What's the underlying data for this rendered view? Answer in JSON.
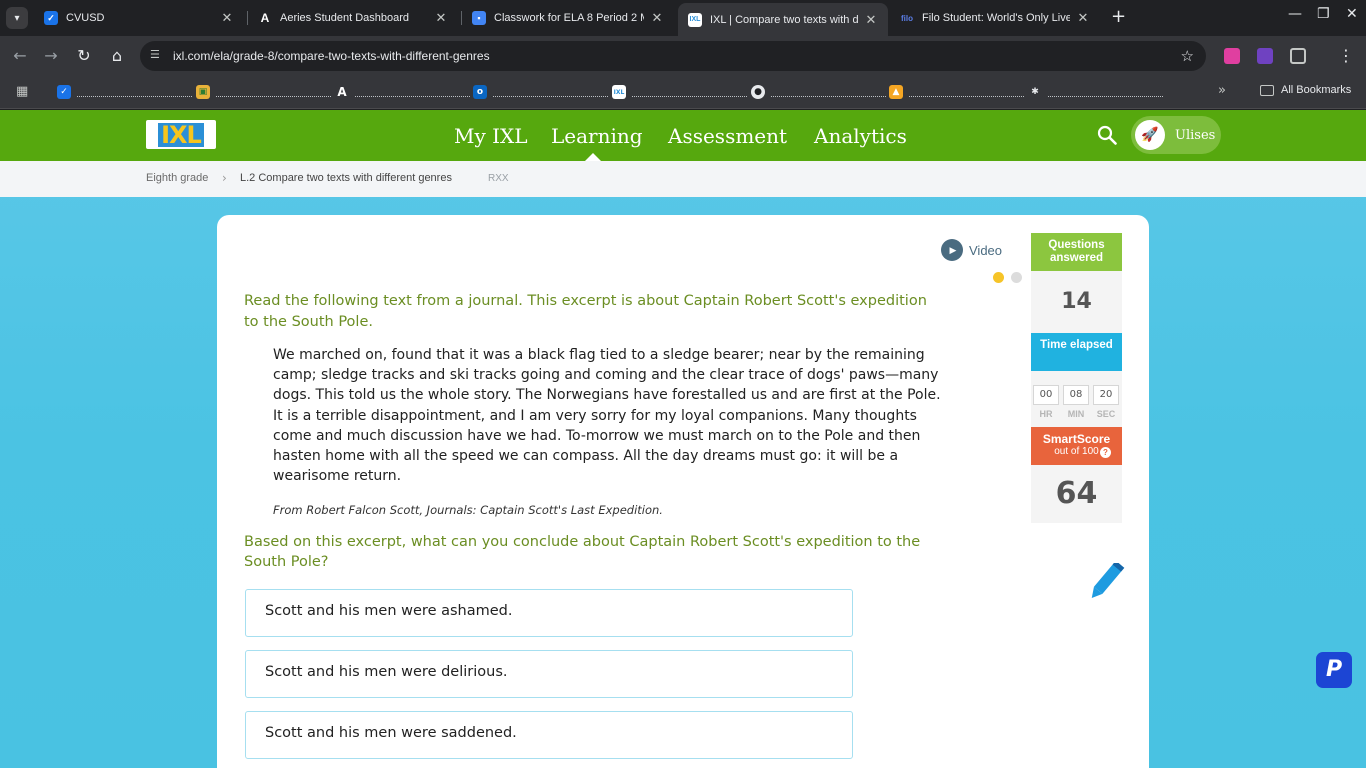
{
  "browser": {
    "tabs": [
      {
        "title": "CVUSD",
        "active": false
      },
      {
        "title": "Aeries Student Dashboard",
        "active": false
      },
      {
        "title": "Classwork for ELA 8 Period 2 M",
        "active": false
      },
      {
        "title": "IXL | Compare two texts with di",
        "active": true
      },
      {
        "title": "Filo Student: World's Only Live I",
        "active": false
      }
    ],
    "url": "ixl.com/ela/grade-8/compare-two-texts-with-different-genres",
    "bookmarks_all_label": "All Bookmarks"
  },
  "ixl": {
    "logo": "IXL",
    "nav": [
      "My IXL",
      "Learning",
      "Assessment",
      "Analytics"
    ],
    "active_nav": "Learning",
    "user_name": "Ulises",
    "breadcrumb": {
      "grade": "Eighth grade",
      "skill": "L.2 Compare two texts with different genres",
      "code": "RXX"
    },
    "video_label": "Video",
    "prompt": "Read the following text from a journal. This excerpt is about Captain Robert Scott's expedition to the South Pole.",
    "passage": "We marched on, found that it was a black flag tied to a sledge bearer; near by the remaining camp; sledge tracks and ski tracks going and coming and the clear trace of dogs' paws—many dogs. This told us the whole story. The Norwegians have forestalled us and are first at the Pole. It is a terrible disappointment, and I am very sorry for my loyal companions. Many thoughts come and much discussion have we had. To-morrow we must march on to the Pole and then hasten home with all the speed we can compass. All the day dreams must go: it will be a wearisome return.",
    "citation": "From Robert Falcon Scott, Journals: Captain Scott's Last Expedition.",
    "question": "Based on this excerpt, what can you conclude about Captain Robert Scott's expedition to the South Pole?",
    "choices": [
      "Scott and his men were ashamed.",
      "Scott and his men were delirious.",
      "Scott and his men were saddened."
    ],
    "stats": {
      "questions_label": "Questions answered",
      "questions_value": "14",
      "time_label": "Time elapsed",
      "time": {
        "hr": "00",
        "min": "08",
        "sec": "20"
      },
      "time_units": {
        "hr": "HR",
        "min": "MIN",
        "sec": "SEC"
      },
      "smartscore_label": "SmartScore",
      "smartscore_sub": "out of 100",
      "smartscore_help": "?",
      "smartscore_value": "64"
    },
    "floating_badge": "P"
  },
  "colors": {
    "ixl_green": "#56a80e",
    "questions_green": "#8cc63f",
    "time_blue": "#20b2e0",
    "smartscore_orange": "#e8643c",
    "prompt_text": "#6b8e23",
    "page_bg": "#4bc3e3"
  }
}
